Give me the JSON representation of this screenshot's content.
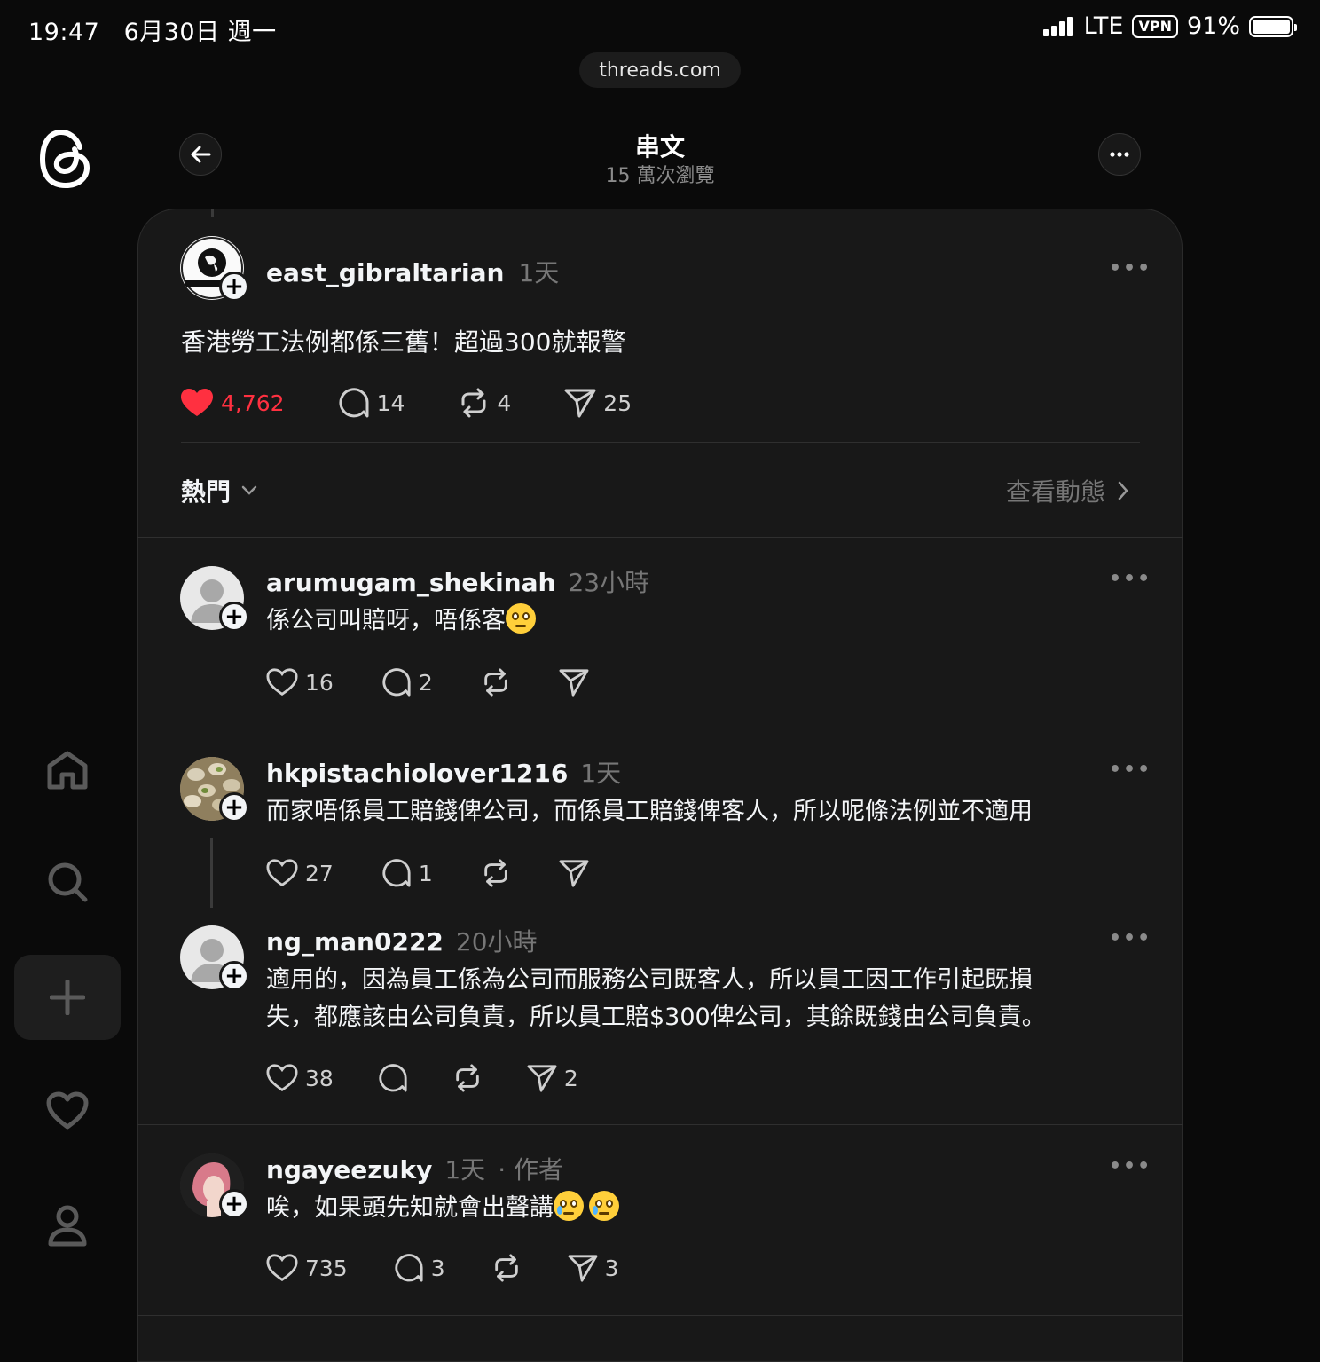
{
  "status_bar": {
    "time": "19:47",
    "date": "6月30日 週一",
    "network": "LTE",
    "vpn": "VPN",
    "battery": "91%"
  },
  "browser": {
    "url": "threads.com"
  },
  "header": {
    "title": "串文",
    "views": "15 萬次瀏覽"
  },
  "main_post": {
    "username": "east_gibraltarian",
    "time": "1天",
    "text": "香港勞工法例都係三舊！超過300就報警",
    "likes": "4,762",
    "replies": "14",
    "reposts": "4",
    "shares": "25"
  },
  "sort": {
    "label": "熱門",
    "activity_link": "查看動態"
  },
  "replies": [
    {
      "username": "arumugam_shekinah",
      "time": "23小時",
      "text": "係公司叫賠呀，唔係客",
      "likes": "16",
      "replies": "2"
    },
    {
      "username": "hkpistachiolover1216",
      "time": "1天",
      "text": "而家唔係員工賠錢俾公司，而係員工賠錢俾客人，所以呢條法例並不適用",
      "likes": "27",
      "replies": "1"
    },
    {
      "username": "ng_man0222",
      "time": "20小時",
      "text_line1": "適用的，因為員工係為公司而服務公司既客人，所以員工因工作引起既損",
      "text_line2": "失，都應該由公司負責，所以員工賠$300俾公司，其餘既錢由公司負責。",
      "likes": "38",
      "shares": "2"
    },
    {
      "username": "ngayeezuky",
      "time": "1天",
      "author_tag": "· 作者",
      "text": "唉，如果頭先知就會出聲講",
      "likes": "735",
      "replies": "3",
      "shares": "3"
    }
  ],
  "icons": {
    "logo": "threads-logo-icon",
    "home": "home-icon",
    "search": "search-icon",
    "create": "plus-icon",
    "activity": "heart-icon",
    "profile": "person-icon"
  },
  "colors": {
    "like": "#ff3040",
    "background": "#0a0a0a",
    "card": "#181818"
  }
}
